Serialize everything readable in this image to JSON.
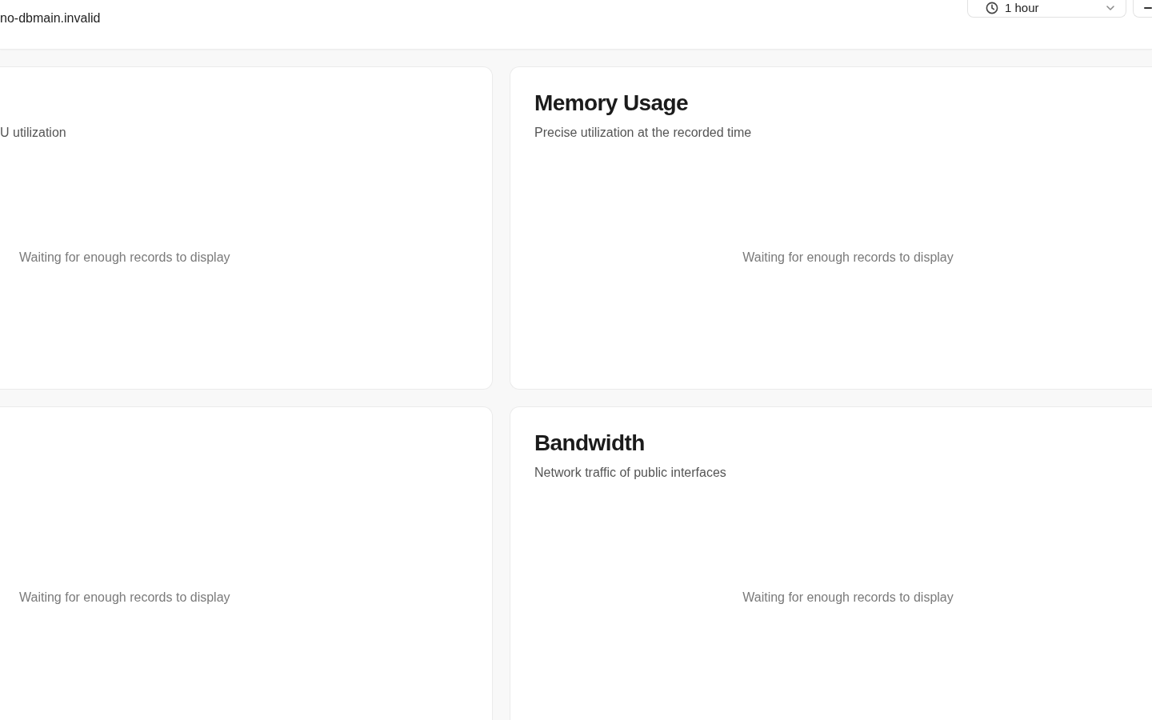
{
  "header": {
    "host": "no-dbmain.invalid",
    "range_select": {
      "value": "1 hour"
    }
  },
  "cards": [
    {
      "subtitle": "U utilization",
      "message": "Waiting for enough records to display"
    },
    {
      "title": "Memory Usage",
      "subtitle": "Precise utilization at the recorded time",
      "message": "Waiting for enough records to display"
    },
    {
      "message": "Waiting for enough records to display"
    },
    {
      "title": "Bandwidth",
      "subtitle": "Network traffic of public interfaces",
      "message": "Waiting for enough records to display"
    }
  ]
}
